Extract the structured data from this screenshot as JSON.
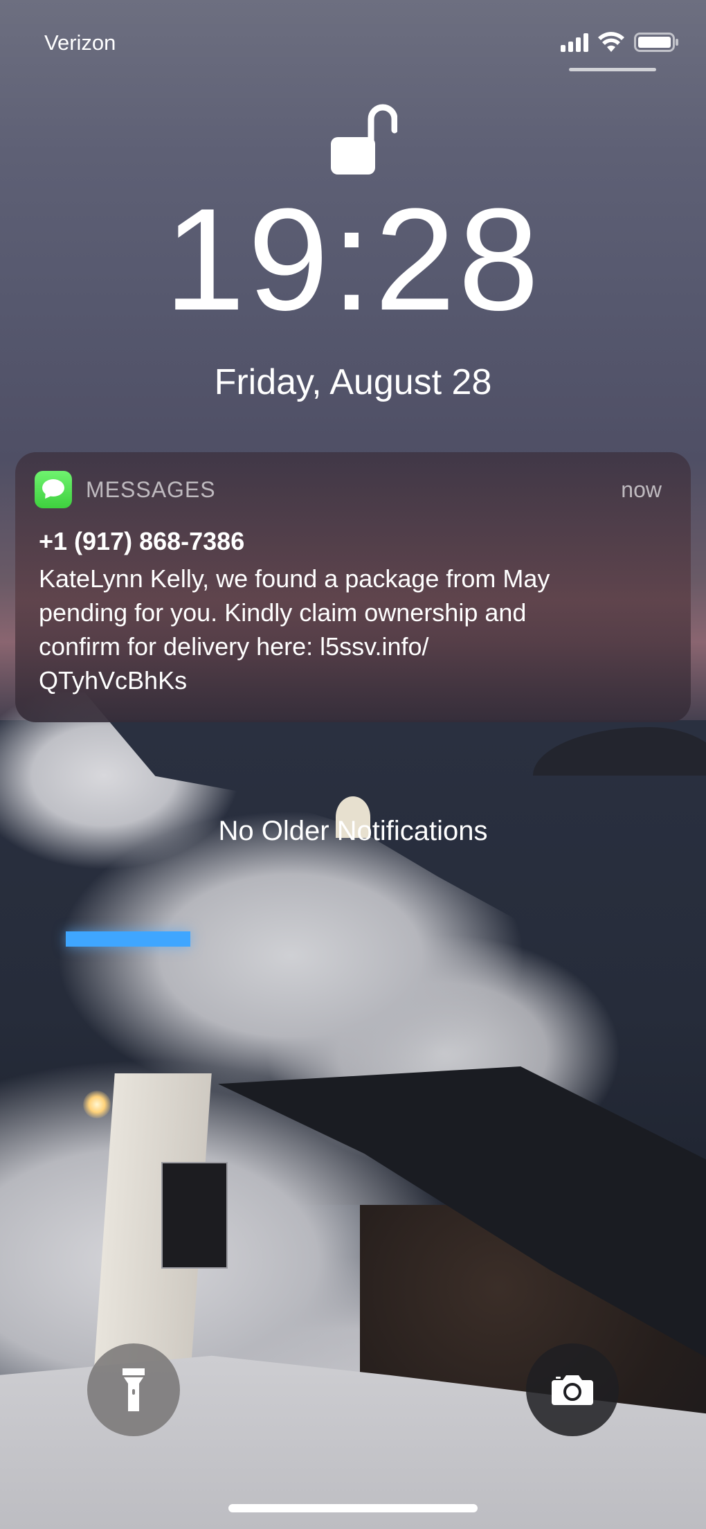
{
  "status_bar": {
    "carrier": "Verizon",
    "signal_icon": "cellular-signal-icon",
    "wifi_icon": "wifi-icon",
    "battery_icon": "battery-icon"
  },
  "lock": {
    "icon": "unlocked-padlock-icon",
    "time": "19:28",
    "date": "Friday, August 28"
  },
  "notification": {
    "app_icon": "messages-app-icon",
    "app_name": "MESSAGES",
    "timestamp": "now",
    "sender": "+1 (917) 868-7386",
    "body_lines": [
      "KateLynn Kelly, we found a package from May",
      "pending for you. Kindly claim ownership and",
      "confirm for delivery here: l5ssv.info/",
      "QTyhVcBhKs"
    ],
    "accent_color": "#4cd964"
  },
  "notification_center": {
    "empty_text": "No Older Notifications"
  },
  "bottom_controls": {
    "flashlight_icon": "flashlight-icon",
    "camera_icon": "camera-icon"
  }
}
